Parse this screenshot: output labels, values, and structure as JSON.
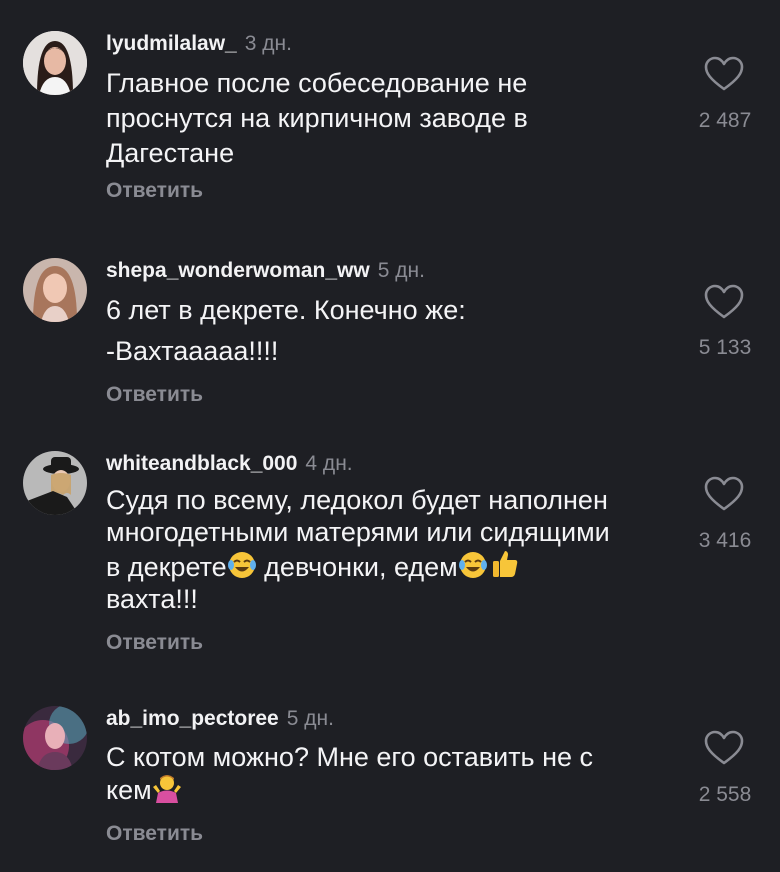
{
  "comments": [
    {
      "username": "lyudmilalaw_",
      "time": "3 дн.",
      "lines": [
        "Главное после собеседование не",
        "проснутся на кирпичном заводе в",
        "Дагестане"
      ],
      "likes": "2 487",
      "reply": "Ответить",
      "avatar_icon": "avatar-woman-dark-hair"
    },
    {
      "username": "shepa_wonderwoman_ww",
      "time": "5 дн.",
      "lines": [
        "6 лет в декрете. Конечно же:",
        "-Вахтааааа!!!!"
      ],
      "likes": "5 133",
      "reply": "Ответить",
      "avatar_icon": "avatar-woman-light-hair"
    },
    {
      "username": "whiteandblack_000",
      "time": "4 дн.",
      "lines": [
        "Судя по всему, ледокол будет наполнен",
        "многодетными матерями или сидящими",
        "в декрете",
        "девчонки, едем",
        "вахта!!!"
      ],
      "likes": "3 416",
      "reply": "Ответить",
      "avatar_icon": "avatar-woman-hat"
    },
    {
      "username": "ab_imo_pectoree",
      "time": "5 дн.",
      "lines": [
        "С котом можно? Мне его оставить не с",
        "кем"
      ],
      "likes": "2 558",
      "reply": "Ответить",
      "avatar_icon": "avatar-woman-pink-light"
    }
  ],
  "colors": {
    "background": "#1e1f24",
    "text_primary": "#f2f2f4",
    "text_secondary": "#8a8b93"
  }
}
